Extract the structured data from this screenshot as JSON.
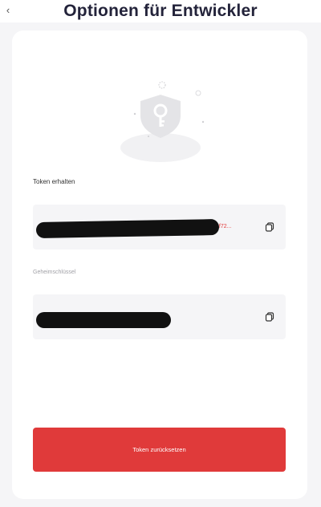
{
  "header": {
    "title": "Optionen für Entwickler",
    "back_glyph": "‹",
    "back_icon": "chevron-left-icon"
  },
  "illustration": {
    "icon": "shield-key-icon"
  },
  "token_section": {
    "label": "Token erhalten",
    "value_visible_start": "...",
    "value_visible_end": "6f72...",
    "copy_icon": "copy-icon"
  },
  "secret_section": {
    "label": "Geheimschlüssel",
    "copy_icon": "copy-icon"
  },
  "reset_button": {
    "label": "Token zurücksetzen"
  },
  "colors": {
    "accent": "#e03a3a",
    "title": "#23233a",
    "background": "#f5f5f7",
    "field": "#f5f5f7"
  }
}
